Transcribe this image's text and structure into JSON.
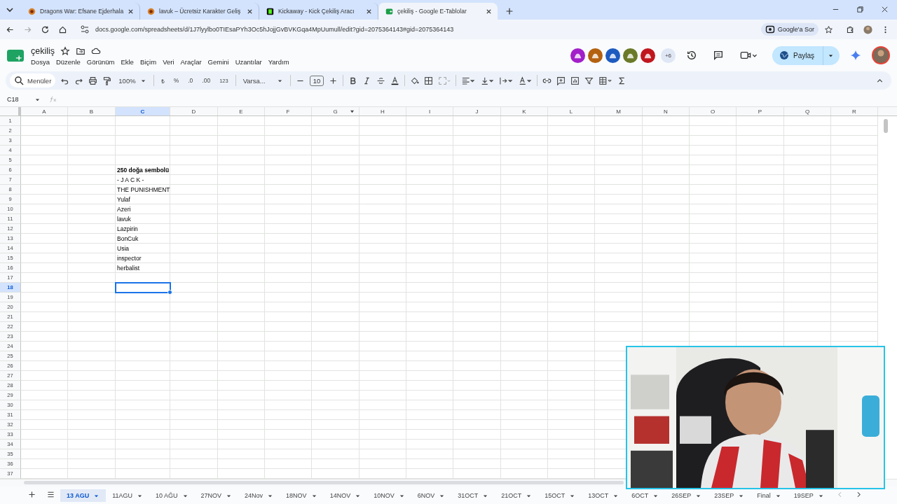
{
  "browser": {
    "tabs": [
      {
        "title": "Dragons War: Efsane Ejderhala",
        "selected": false,
        "kind": "game"
      },
      {
        "title": "lavuk – Ücretsiz Karakter Geliş",
        "selected": false,
        "kind": "game"
      },
      {
        "title": "Kickaway - Kick Çekiliş Aracı",
        "selected": false,
        "kind": "kick"
      },
      {
        "title": "çekiliş - Google E-Tablolar",
        "selected": true,
        "kind": "sheets"
      }
    ],
    "url": "docs.google.com/spreadsheets/d/1J7lyylbo0TIEsaPYh3Oc5hJojjGvBVKGqa4MpUumull/edit?gid=2075364143#gid=2075364143",
    "ask_button": "Google'a Sor"
  },
  "document": {
    "title": "çekiliş",
    "menus": [
      "Dosya",
      "Düzenle",
      "Görünüm",
      "Ekle",
      "Biçim",
      "Veri",
      "Araçlar",
      "Gemini",
      "Uzantılar",
      "Yardım"
    ],
    "collaborators": [
      {
        "color": "#a21fc9"
      },
      {
        "color": "#b4610f"
      },
      {
        "color": "#1e5bc0"
      },
      {
        "color": "#6a7a28"
      },
      {
        "color": "#c0161d"
      }
    ],
    "more_collaborators": "+6",
    "share_button": "Paylaş"
  },
  "toolbar": {
    "search": "Menüler",
    "zoom": "100%",
    "currency": "₺",
    "percent": "%",
    "decrease_decimals": ".0",
    "increase_decimals": ".00",
    "number_format": "123",
    "font": "Varsa...",
    "font_size": "10"
  },
  "formula_bar": {
    "cell_reference": "C18"
  },
  "sheet": {
    "columns": [
      {
        "label": "A",
        "selected": false
      },
      {
        "label": "B",
        "selected": false
      },
      {
        "label": "C",
        "selected": true
      },
      {
        "label": "D",
        "selected": false
      },
      {
        "label": "E",
        "selected": false
      },
      {
        "label": "F",
        "selected": false
      },
      {
        "label": "G",
        "selected": false,
        "filter": true
      },
      {
        "label": "H",
        "selected": false
      },
      {
        "label": "I",
        "selected": false
      },
      {
        "label": "J",
        "selected": false
      },
      {
        "label": "K",
        "selected": false
      },
      {
        "label": "L",
        "selected": false
      },
      {
        "label": "M",
        "selected": false
      },
      {
        "label": "N",
        "selected": false
      },
      {
        "label": "O",
        "selected": false
      },
      {
        "label": "P",
        "selected": false
      },
      {
        "label": "Q",
        "selected": false
      },
      {
        "label": "R",
        "selected": false
      }
    ],
    "rows": [
      {
        "number": "1",
        "selected": false
      },
      {
        "number": "2",
        "selected": false
      },
      {
        "number": "3",
        "selected": false
      },
      {
        "number": "4",
        "selected": false
      },
      {
        "number": "5",
        "selected": false
      },
      {
        "number": "6",
        "selected": false,
        "column_c": {
          "text": "250 doğa sembolü",
          "bold": true
        }
      },
      {
        "number": "7",
        "selected": false,
        "column_c": {
          "text": "- J A C K -",
          "bold": false
        }
      },
      {
        "number": "8",
        "selected": false,
        "column_c": {
          "text": "THE PUNISHMENT",
          "bold": false
        }
      },
      {
        "number": "9",
        "selected": false,
        "column_c": {
          "text": "Yulaf",
          "bold": false
        }
      },
      {
        "number": "10",
        "selected": false,
        "column_c": {
          "text": "Azeri",
          "bold": false
        }
      },
      {
        "number": "11",
        "selected": false,
        "column_c": {
          "text": "lavuk",
          "bold": false
        }
      },
      {
        "number": "12",
        "selected": false,
        "column_c": {
          "text": "Lazpirin",
          "bold": false
        }
      },
      {
        "number": "13",
        "selected": false,
        "column_c": {
          "text": "BonCuk",
          "bold": false
        }
      },
      {
        "number": "14",
        "selected": false,
        "column_c": {
          "text": "Usia",
          "bold": false
        }
      },
      {
        "number": "15",
        "selected": false,
        "column_c": {
          "text": "inspector",
          "bold": false
        }
      },
      {
        "number": "16",
        "selected": false,
        "column_c": {
          "text": "herbalist",
          "bold": false
        }
      },
      {
        "number": "17",
        "selected": false
      },
      {
        "number": "18",
        "selected": true
      },
      {
        "number": "19",
        "selected": false
      },
      {
        "number": "20",
        "selected": false
      },
      {
        "number": "21",
        "selected": false
      },
      {
        "number": "22",
        "selected": false
      },
      {
        "number": "23",
        "selected": false
      },
      {
        "number": "24",
        "selected": false
      },
      {
        "number": "25",
        "selected": false
      },
      {
        "number": "26",
        "selected": false
      },
      {
        "number": "27",
        "selected": false
      },
      {
        "number": "28",
        "selected": false
      },
      {
        "number": "29",
        "selected": false
      },
      {
        "number": "30",
        "selected": false
      },
      {
        "number": "31",
        "selected": false
      },
      {
        "number": "32",
        "selected": false
      },
      {
        "number": "33",
        "selected": false
      },
      {
        "number": "34",
        "selected": false
      },
      {
        "number": "35",
        "selected": false
      },
      {
        "number": "36",
        "selected": false
      },
      {
        "number": "37",
        "selected": false
      }
    ]
  },
  "sheet_tabs": [
    {
      "label": "13 AGU",
      "selected": true
    },
    {
      "label": "11AGU",
      "selected": false
    },
    {
      "label": "10 AĞU",
      "selected": false
    },
    {
      "label": "27NOV",
      "selected": false
    },
    {
      "label": "24Nov",
      "selected": false
    },
    {
      "label": "18NOV",
      "selected": false
    },
    {
      "label": "14NOV",
      "selected": false
    },
    {
      "label": "10NOV",
      "selected": false
    },
    {
      "label": "6NOV",
      "selected": false
    },
    {
      "label": "31OCT",
      "selected": false
    },
    {
      "label": "21OCT",
      "selected": false
    },
    {
      "label": "15OCT",
      "selected": false
    },
    {
      "label": "13OCT",
      "selected": false
    },
    {
      "label": "6OCT",
      "selected": false
    },
    {
      "label": "26SEP",
      "selected": false
    },
    {
      "label": "23SEP",
      "selected": false
    },
    {
      "label": "Final",
      "selected": false
    },
    {
      "label": "19SEP",
      "selected": false
    }
  ]
}
